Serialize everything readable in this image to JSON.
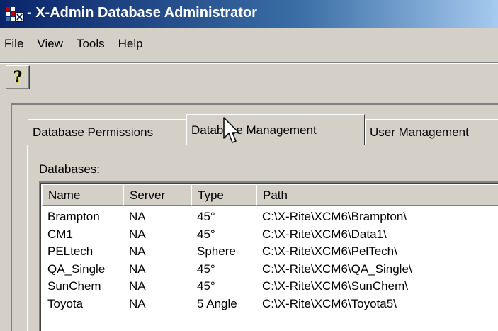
{
  "window": {
    "title": "- X-Admin Database Administrator"
  },
  "menu": [
    "File",
    "View",
    "Tools",
    "Help"
  ],
  "toolbar": {
    "help_label": "?"
  },
  "tabs": [
    {
      "label": "Database Permissions",
      "active": false
    },
    {
      "label": "Database Management",
      "active": true
    },
    {
      "label": "User Management",
      "active": false
    }
  ],
  "databases": {
    "label": "Databases:",
    "columns": [
      "Name",
      "Server",
      "Type",
      "Path"
    ],
    "rows": [
      {
        "name": "Brampton",
        "server": "NA",
        "type": "45°",
        "path": "C:\\X-Rite\\XCM6\\Brampton\\"
      },
      {
        "name": "CM1",
        "server": "NA",
        "type": "45°",
        "path": "C:\\X-Rite\\XCM6\\Data1\\"
      },
      {
        "name": "PELtech",
        "server": "NA",
        "type": "Sphere",
        "path": "C:\\X-Rite\\XCM6\\PelTech\\"
      },
      {
        "name": "QA_Single",
        "server": "NA",
        "type": "45°",
        "path": "C:\\X-Rite\\XCM6\\QA_Single\\"
      },
      {
        "name": "SunChem",
        "server": "NA",
        "type": "45°",
        "path": "C:\\X-Rite\\XCM6\\SunChem\\"
      },
      {
        "name": "Toyota",
        "server": "NA",
        "type": "5 Angle",
        "path": "C:\\X-Rite\\XCM6\\Toyota5\\"
      }
    ]
  },
  "colors": {
    "titlebar_start": "#0a246a",
    "titlebar_end": "#a6caf0",
    "chrome": "#d4d0c8"
  }
}
